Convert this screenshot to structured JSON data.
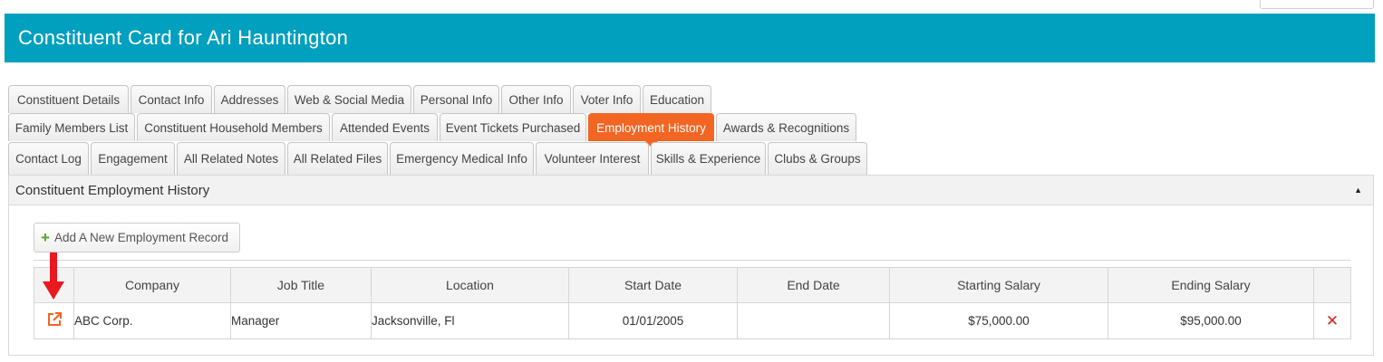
{
  "title": "Constituent Card for Ari Hauntington",
  "tabs": {
    "row1": [
      "Constituent Details",
      "Contact Info",
      "Addresses",
      "Web & Social Media",
      "Personal Info",
      "Other Info",
      "Voter Info",
      "Education"
    ],
    "row2": [
      "Family Members List",
      "Constituent Household Members",
      "Attended Events",
      "Event Tickets Purchased",
      "Employment History",
      "Awards & Recognitions"
    ],
    "row3": [
      "Contact Log",
      "Engagement",
      "All Related Notes",
      "All Related Files",
      "Emergency Medical Info",
      "Volunteer Interest",
      "Skills & Experience",
      "Clubs & Groups"
    ],
    "active": "Employment History"
  },
  "panel": {
    "title": "Constituent Employment History",
    "collapse_icon": "▲",
    "add_button": "Add A New Employment Record"
  },
  "table": {
    "headers": [
      "Company",
      "Job Title",
      "Location",
      "Start Date",
      "End Date",
      "Starting Salary",
      "Ending Salary"
    ],
    "rows": [
      {
        "company": "ABC Corp.",
        "job_title": "Manager",
        "location": "Jacksonville, Fl",
        "start_date": "01/01/2005",
        "end_date": "",
        "starting_salary": "$75,000.00",
        "ending_salary": "$95,000.00"
      }
    ]
  },
  "colors": {
    "title_bar": "#00a0be",
    "active_tab": "#f26522",
    "edit_icon": "#f26522",
    "delete_icon": "#d9281c",
    "annotation_arrow": "#e8191f"
  },
  "icons": {
    "edit": "external-link-icon",
    "delete": "close-x-icon",
    "add": "plus-icon",
    "annotation": "red-down-arrow"
  }
}
